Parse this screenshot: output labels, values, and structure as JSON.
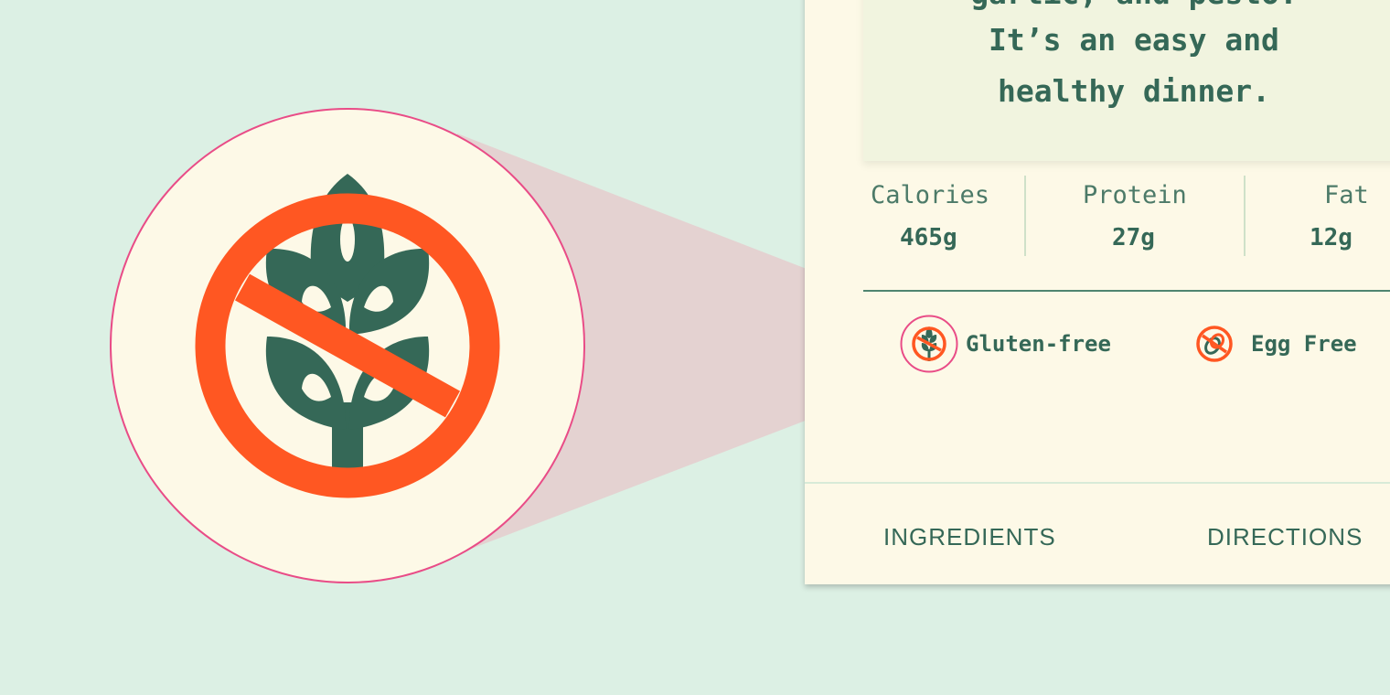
{
  "description": {
    "lines": [
      "garlic, and pesto.",
      "It’s an easy and",
      "healthy dinner."
    ]
  },
  "nutrition": [
    {
      "label": "Calories",
      "value": "465g"
    },
    {
      "label": "Protein",
      "value": "27g"
    },
    {
      "label": "Fat",
      "value": "12g"
    }
  ],
  "dietary": [
    {
      "label": "Gluten-free",
      "icon": "no-wheat-icon"
    },
    {
      "label": "Egg Free",
      "icon": "no-egg-icon"
    }
  ],
  "tabs": [
    {
      "label": "INGREDIENTS"
    },
    {
      "label": "DIRECTIONS"
    }
  ],
  "zoom_callout": {
    "icon": "no-wheat-icon"
  },
  "colors": {
    "background": "#dcf0e4",
    "card": "#fdf9e7",
    "primary_green": "#356857",
    "prohibition_orange": "#ff5722",
    "highlight_pink": "#e94c87"
  }
}
